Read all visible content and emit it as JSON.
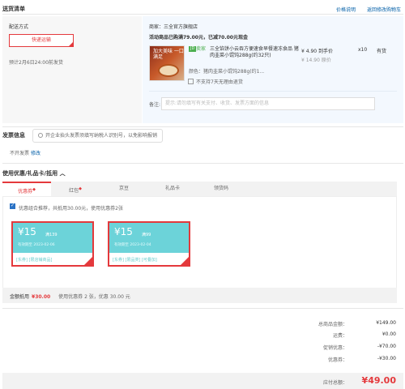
{
  "delivery": {
    "title": "送货清单",
    "links": [
      "价格说明",
      "返回修改购物车"
    ],
    "method_label": "配送方式",
    "method_value": "快递运输",
    "estimate": "预计2月6日24:00前发货"
  },
  "order": {
    "seller": "商家：三全官方旗舰店",
    "promo": "活动商品已购满79.00元，已减70.00元现金",
    "thumb_text": "加大美味 一口满足",
    "tag_self": "JD",
    "tag_seller": "卖家",
    "product_name": "三全馅饼小云吞方便速食早餐速冻食品 猪肉韭菜小馄饨288g(约32只)",
    "spec": "颜色：猪肉韭菜小馄饨288g(约1...",
    "no_return": "不支持7天无理由退货",
    "price": "¥ 4.90 到手价",
    "orig_price": "¥ 14.90 原价",
    "qty": "x10",
    "stock": "有货",
    "remark_label": "备注:",
    "remark_placeholder": "提示:请勿填写有关支付、收货、发票方面的信息"
  },
  "invoice": {
    "title": "发票信息",
    "tip": "开企业抬头发票须填写纳税人识别号，以免影响报销",
    "value": "不开发票",
    "edit": "修改"
  },
  "coupons": {
    "title": "使用优惠/礼品卡/抵用",
    "tabs": [
      "优惠券",
      "红包",
      "京豆",
      "礼品卡",
      "领货码"
    ],
    "tabs_marked": [
      true,
      true,
      false,
      false,
      false
    ],
    "check_text": "优惠组合推荐，共抵用30.00元，使用优惠券2张",
    "items": [
      {
        "amount": "¥15",
        "cond": "满139",
        "expire": "有效期至 2023-02-06",
        "cats": "[东券] [限店铺商品]"
      },
      {
        "amount": "¥15",
        "cond": "满99",
        "expire": "有效期至 2023-02-04",
        "cats": "[东券] [限品类] [可叠加]"
      }
    ],
    "summary_label": "金额抵用",
    "summary_amount": "¥30.00",
    "summary_used": "使用优惠券 2 张，优惠 30.00 元"
  },
  "totals": [
    {
      "label": "总商品金额：",
      "value": "¥149.00"
    },
    {
      "label": "运费：",
      "value": "¥0.00"
    },
    {
      "label": "促销优惠：",
      "value": "-¥70.00"
    },
    {
      "label": "优惠券：",
      "value": "-¥30.00"
    }
  ],
  "payable": {
    "label": "应付总额：",
    "value": "¥49.00"
  },
  "colors": {
    "accent": "#e4393c",
    "link": "#005ea7",
    "coupon": "#6cd3d9"
  }
}
